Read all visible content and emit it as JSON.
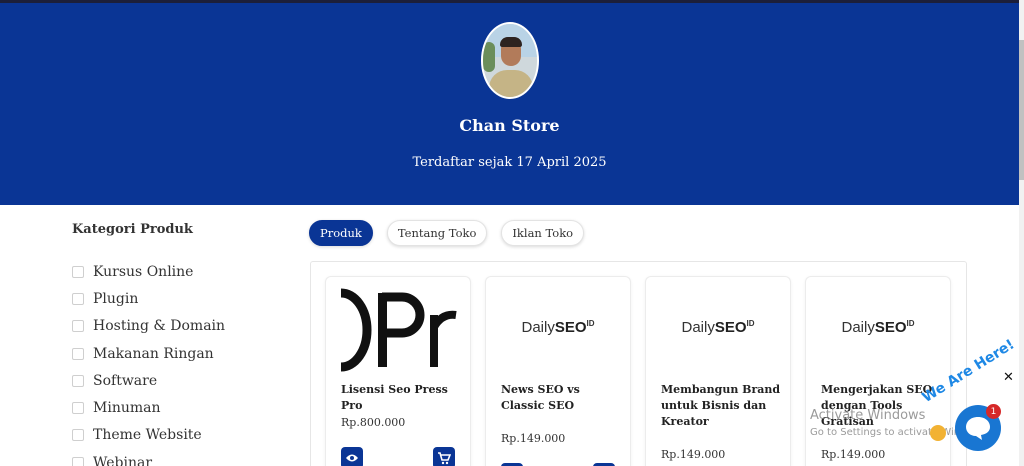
{
  "header": {
    "store_name": "Chan Store",
    "registered_since": "Terdaftar sejak 17 April 2025"
  },
  "sidebar": {
    "title": "Kategori Produk",
    "categories": [
      {
        "label": "Kursus Online",
        "checked": false
      },
      {
        "label": "Plugin",
        "checked": false
      },
      {
        "label": "Hosting & Domain",
        "checked": false
      },
      {
        "label": "Makanan Ringan",
        "checked": false
      },
      {
        "label": "Software",
        "checked": false
      },
      {
        "label": "Minuman",
        "checked": false
      },
      {
        "label": "Theme Website",
        "checked": false
      },
      {
        "label": "Webinar",
        "checked": false
      }
    ]
  },
  "tabs": [
    {
      "label": "Produk",
      "active": true
    },
    {
      "label": "Tentang Toko",
      "active": false
    },
    {
      "label": "Iklan Toko",
      "active": false
    }
  ],
  "products": [
    {
      "title": "Lisensi Seo Press Pro",
      "price": "Rp.800.000",
      "thumb": "OPr"
    },
    {
      "title": "News SEO vs Classic SEO",
      "price": "Rp.149.000",
      "thumb": "DailySEO"
    },
    {
      "title": "Membangun Brand untuk Bisnis dan Kreator",
      "price": "Rp.149.000",
      "thumb": "DailySEO"
    },
    {
      "title": "Mengerjakan SEO dengan Tools Gratisan",
      "price": "Rp.149.000",
      "thumb": "DailySEO"
    }
  ],
  "logo_text": {
    "daily": "Daily",
    "seo": "SEO",
    "id": "ID"
  },
  "chat_widget": {
    "tagline": "We Are Here!",
    "badge_count": "1",
    "close_symbol": "✕"
  },
  "watermark": {
    "line1": "Activate Windows",
    "line2": "Go to Settings to activate Windows."
  },
  "colors": {
    "primary": "#0a3595",
    "chat_blue": "#1976d2",
    "badge_red": "#d62828"
  },
  "icons": {
    "view": "eye-icon",
    "cart": "cart-icon",
    "chat": "chat-icon"
  }
}
